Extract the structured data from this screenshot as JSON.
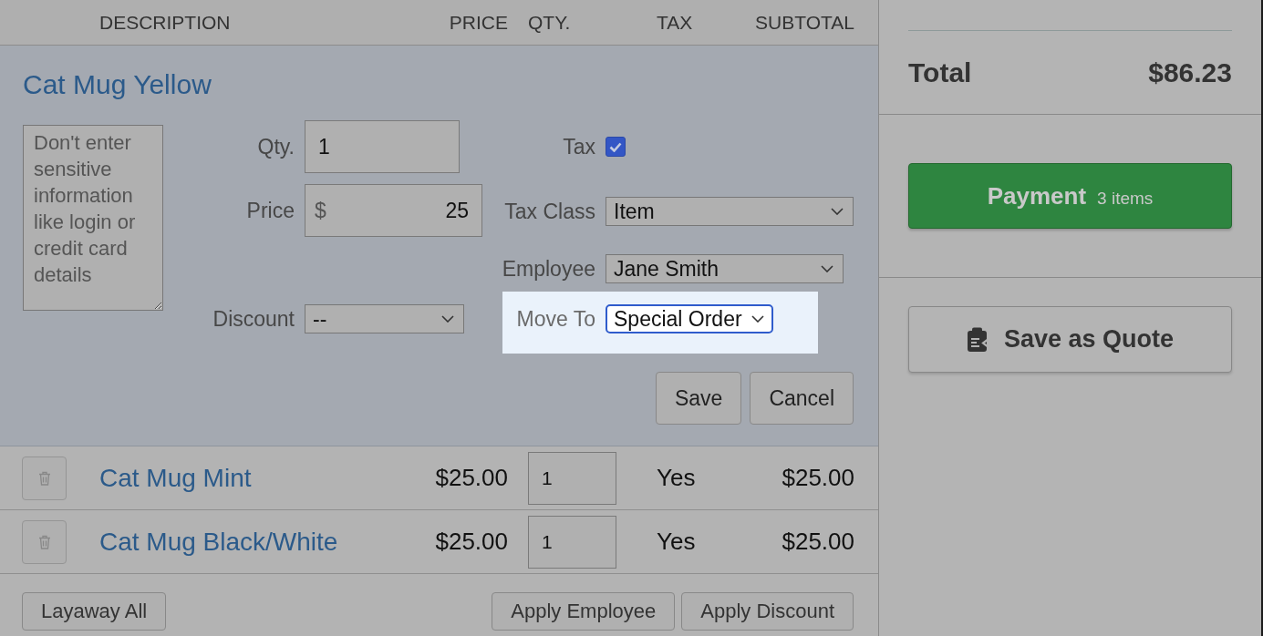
{
  "table": {
    "columns": [
      {
        "label": "DESCRIPTION"
      },
      {
        "label": "PRICE"
      },
      {
        "label": "QTY."
      },
      {
        "label": "TAX"
      },
      {
        "label": "SUBTOTAL"
      }
    ]
  },
  "edit_item": {
    "title": "Cat Mug Yellow",
    "notes": {
      "placeholder": "Don't enter sensitive information like login or credit card details"
    },
    "left_fields": [
      {
        "kind": "text",
        "label": "Qty.",
        "value": "1"
      },
      {
        "kind": "currency",
        "label": "Price",
        "prefix": "$",
        "value": "25"
      },
      {
        "kind": "select",
        "label": "Discount",
        "value": "--"
      }
    ],
    "right_fields": [
      {
        "kind": "checkbox",
        "label": "Tax",
        "checked": true,
        "highlighted": false
      },
      {
        "kind": "select",
        "label": "Tax Class",
        "value": "Item",
        "highlighted": false
      },
      {
        "kind": "select",
        "label": "Employee",
        "value": "Jane Smith",
        "highlighted": false
      },
      {
        "kind": "select",
        "label": "Move To",
        "value": "Special Order",
        "highlighted": true
      }
    ],
    "buttons": [
      {
        "label": "Save"
      },
      {
        "label": "Cancel"
      }
    ]
  },
  "line_items": [
    {
      "name": "Cat Mug Mint",
      "price": "$25.00",
      "qty": "1",
      "tax": "Yes",
      "subtotal": "$25.00"
    },
    {
      "name": "Cat Mug Black/White",
      "price": "$25.00",
      "qty": "1",
      "tax": "Yes",
      "subtotal": "$25.00"
    }
  ],
  "footer_buttons": [
    {
      "label": "Layaway All"
    },
    {
      "label": "Apply Employee"
    },
    {
      "label": "Apply Discount"
    }
  ],
  "summary": {
    "total_label": "Total",
    "total": "$86.23"
  },
  "payment": {
    "label": "Payment",
    "count": "3 items"
  },
  "quote_button": {
    "label": "Save as Quote"
  }
}
